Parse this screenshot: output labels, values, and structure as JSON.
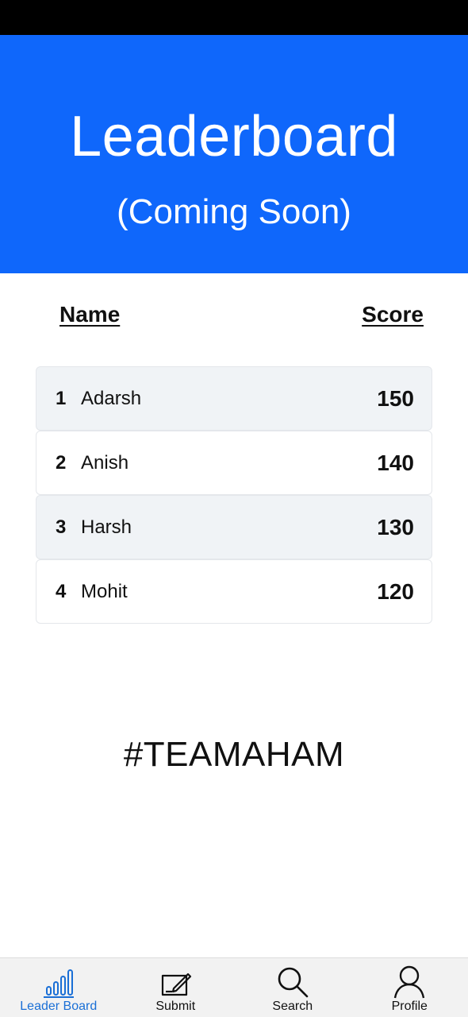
{
  "header": {
    "title": "Leaderboard",
    "subtitle": "(Coming Soon)",
    "background_color": "#0f67fb"
  },
  "table": {
    "columns": {
      "name": "Name",
      "score": "Score"
    },
    "rows": [
      {
        "rank": "1",
        "name": "Adarsh",
        "score": "150"
      },
      {
        "rank": "2",
        "name": "Anish",
        "score": "140"
      },
      {
        "rank": "3",
        "name": "Harsh",
        "score": "130"
      },
      {
        "rank": "4",
        "name": "Mohit",
        "score": "120"
      }
    ],
    "alt_row_color": "#f0f3f6"
  },
  "tagline": "#TEAMAHAM",
  "bottom_nav": {
    "active_color": "#1a6fd6",
    "items": [
      {
        "label": "Leader Board",
        "icon": "bar-chart-icon",
        "active": true
      },
      {
        "label": "Submit",
        "icon": "edit-icon",
        "active": false
      },
      {
        "label": "Search",
        "icon": "search-icon",
        "active": false
      },
      {
        "label": "Profile",
        "icon": "profile-icon",
        "active": false
      }
    ]
  }
}
